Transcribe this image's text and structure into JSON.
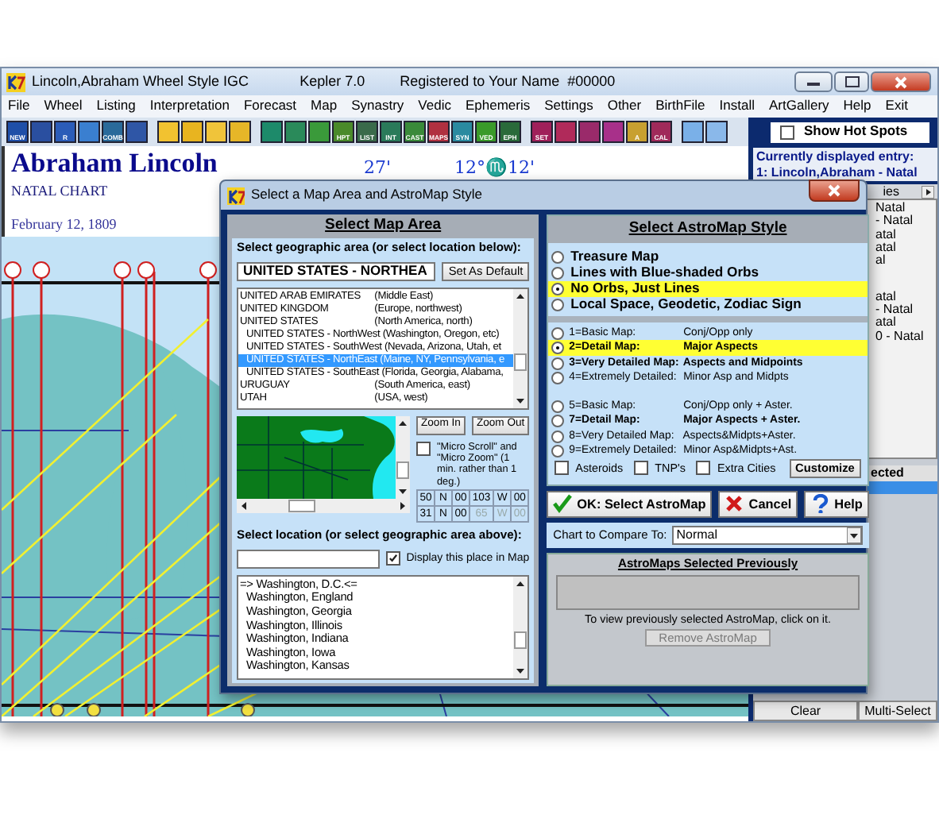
{
  "window": {
    "title": "Lincoln,Abraham Wheel Style IGC",
    "app": "Kepler 7.0",
    "registration": "Registered to Your Name  #00000"
  },
  "menu": [
    "File",
    "Wheel",
    "Listing",
    "Interpretation",
    "Forecast",
    "Map",
    "Synastry",
    "Vedic",
    "Ephemeris",
    "Settings",
    "Other",
    "BirthFile",
    "Install",
    "ArtGallery",
    "Help",
    "Exit"
  ],
  "toolbar_groups": [
    [
      {
        "label": "NEW",
        "color": "#1f4fa8"
      },
      {
        "color": "#2a4fa0"
      },
      {
        "label": "R",
        "color": "#2b5cb8"
      },
      {
        "color": "#3a7fd0"
      },
      {
        "label": "COMB",
        "color": "#2a6a9a"
      },
      {
        "color": "#2f56a6"
      }
    ],
    [
      {
        "color": "#f2c230"
      },
      {
        "color": "#e8b420"
      },
      {
        "color": "#f0c43a"
      },
      {
        "color": "#e6b628"
      }
    ],
    [
      {
        "color": "#1d8a6a"
      },
      {
        "color": "#2a8a5a"
      },
      {
        "color": "#3a9a3a"
      },
      {
        "label": "HPT",
        "color": "#4a8a2a"
      },
      {
        "label": "LIST",
        "color": "#3a6a4a"
      },
      {
        "label": "INT",
        "color": "#2a7a5a"
      },
      {
        "label": "CAST",
        "color": "#3a8a3a"
      },
      {
        "label": "MAPS",
        "color": "#b03040"
      },
      {
        "label": "SYN",
        "color": "#2a8aa0"
      },
      {
        "label": "VED",
        "color": "#3a9a2a"
      },
      {
        "label": "EPH",
        "color": "#2a6a3a"
      }
    ],
    [
      {
        "label": "SET",
        "color": "#a0205a"
      },
      {
        "color": "#b02a5a"
      },
      {
        "color": "#9a2a6a"
      },
      {
        "color": "#a8308a"
      },
      {
        "label": "A",
        "color": "#c8a030"
      },
      {
        "label": "CAL",
        "color": "#a02a5a"
      }
    ],
    [
      {
        "color": "#7ab0e8"
      },
      {
        "color": "#8ab8ea"
      }
    ]
  ],
  "hot_spots": {
    "label": "Show Hot Spots",
    "checked": false
  },
  "current_entry": {
    "heading": "Currently displayed entry:",
    "entry": "1: Lincoln,Abraham - Natal"
  },
  "chart": {
    "name": "Abraham Lincoln",
    "type": "NATAL CHART",
    "date": "February 12, 1809",
    "degree_labels": [
      "27'",
      "12°♏12'"
    ]
  },
  "entries_panel": {
    "header": "ies",
    "items": [
      "Natal",
      "- Natal",
      "atal",
      "atal",
      "al",
      "atal",
      "- Natal",
      "atal",
      "0 - Natal"
    ],
    "selected_header": "ected",
    "buttons": [
      "Clear",
      "Multi-Select"
    ]
  },
  "dialog": {
    "title": "Select a Map Area and AstroMap Style",
    "map_area": {
      "heading": "Select Map Area",
      "area_label": "Select geographic area (or select location below):",
      "area_value": "UNITED STATES - NORTHEA",
      "default_button": "Set As Default",
      "areas": [
        {
          "name": "UNITED ARAB EMIRATES",
          "region": "(Middle East)",
          "indented": false,
          "selected": false
        },
        {
          "name": "UNITED KINGDOM",
          "region": "(Europe, northwest)",
          "indented": false,
          "selected": false
        },
        {
          "name": "UNITED STATES",
          "region": "(North America, north)",
          "indented": false,
          "selected": false
        },
        {
          "name": "UNITED STATES - NorthWest",
          "region": "(Washington, Oregon, etc)",
          "indented": true,
          "selected": false
        },
        {
          "name": "UNITED STATES - SouthWest",
          "region": "(Nevada, Arizona, Utah, et",
          "indented": true,
          "selected": false
        },
        {
          "name": "UNITED STATES - NorthEast",
          "region": "(Maine, NY, Pennsylvania, e",
          "indented": true,
          "selected": true
        },
        {
          "name": "UNITED STATES - SouthEast",
          "region": "(Florida, Georgia, Alabama,",
          "indented": true,
          "selected": false
        },
        {
          "name": "URUGUAY",
          "region": "(South America, east)",
          "indented": false,
          "selected": false
        },
        {
          "name": "UTAH",
          "region": "(USA, west)",
          "indented": false,
          "selected": false
        }
      ],
      "zoom_in": "Zoom In",
      "zoom_out": "Zoom Out",
      "micro": {
        "label": "\"Micro Scroll\" and \"Micro Zoom\" (1 min. rather than 1 deg.)",
        "checked": false
      },
      "coords": [
        [
          {
            "text": "50",
            "disabled": false
          },
          {
            "text": "N",
            "disabled": false
          },
          {
            "text": "00",
            "disabled": false
          },
          {
            "text": "103",
            "disabled": false
          },
          {
            "text": "W",
            "disabled": false
          },
          {
            "text": "00",
            "disabled": false
          }
        ],
        [
          {
            "text": "31",
            "disabled": false
          },
          {
            "text": "N",
            "disabled": false
          },
          {
            "text": "00",
            "disabled": false
          },
          {
            "text": "65",
            "disabled": true
          },
          {
            "text": "W",
            "disabled": true
          },
          {
            "text": "00",
            "disabled": true
          }
        ]
      ],
      "location_label": "Select location (or select geographic area above):",
      "display_in_map": {
        "label": "Display this place in Map",
        "checked": true
      },
      "locations": [
        {
          "name": "=> Washington, D.C.<=",
          "indented": false
        },
        {
          "name": "Washington, England",
          "indented": true
        },
        {
          "name": "Washington, Georgia",
          "indented": true
        },
        {
          "name": "Washington, Illinois",
          "indented": true
        },
        {
          "name": "Washington, Indiana",
          "indented": true
        },
        {
          "name": "Washington, Iowa",
          "indented": true
        },
        {
          "name": "Washington, Kansas",
          "indented": true
        }
      ]
    },
    "style": {
      "heading": "Select AstroMap Style",
      "map_types": [
        {
          "label": "Treasure Map",
          "selected": false
        },
        {
          "label": "Lines with Blue-shaded Orbs",
          "selected": false
        },
        {
          "label": "No Orbs, Just Lines",
          "selected": true
        },
        {
          "label": "Local Space, Geodetic, Zodiac Sign",
          "selected": false
        }
      ],
      "detail_levels": [
        [
          {
            "label": "1=Basic Map:",
            "description": "Conj/Opp only",
            "bold": false,
            "selected": false
          },
          {
            "label": "2=Detail Map:",
            "description": "Major Aspects",
            "bold": true,
            "selected": true
          },
          {
            "label": "3=Very Detailed Map:",
            "description": "Aspects and Midpoints",
            "bold": true,
            "selected": false
          },
          {
            "label": "4=Extremely Detailed:",
            "description": "Minor Asp and Midpts",
            "bold": false,
            "selected": false
          }
        ],
        [
          {
            "label": "5=Basic Map:",
            "description": "Conj/Opp only + Aster.",
            "bold": false,
            "selected": false
          },
          {
            "label": "7=Detail Map:",
            "description": "Major Aspects + Aster.",
            "bold": true,
            "selected": false
          },
          {
            "label": "8=Very Detailed Map:",
            "description": "Aspects&Midpts+Aster.",
            "bold": false,
            "selected": false
          },
          {
            "label": "9=Extremely Detailed:",
            "description": "Minor Asp&Midpts+Ast.",
            "bold": false,
            "selected": false
          }
        ]
      ],
      "extras": [
        {
          "label": "Asteroids",
          "checked": false
        },
        {
          "label": "TNP's",
          "checked": false
        },
        {
          "label": "Extra Cities",
          "checked": false
        }
      ],
      "customize": "Customize"
    },
    "buttons": [
      {
        "label": "OK: Select AstroMap",
        "kind": "ok"
      },
      {
        "label": "Cancel",
        "kind": "cancel"
      },
      {
        "label": "Help",
        "kind": "help"
      }
    ],
    "compare": {
      "label": "Chart to Compare To:",
      "value": "Normal"
    },
    "previous": {
      "heading": "AstroMaps Selected Previously",
      "hint": "To view previously selected AstroMap, click on it.",
      "remove_button": "Remove AstroMap",
      "remove_disabled": true
    }
  }
}
